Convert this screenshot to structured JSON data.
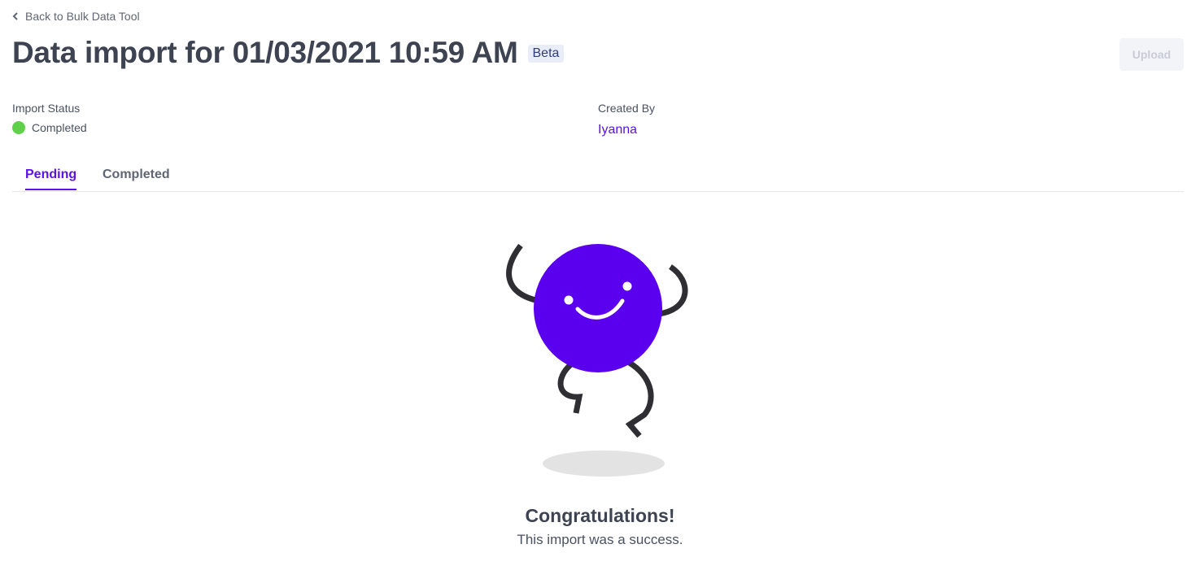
{
  "nav": {
    "back_label": "Back to Bulk Data Tool"
  },
  "header": {
    "title": "Data import for 01/03/2021 10:59 AM",
    "badge": "Beta",
    "upload_label": "Upload"
  },
  "meta": {
    "status_label": "Import Status",
    "status_value": "Completed",
    "status_color": "#5fd04a",
    "created_by_label": "Created By",
    "created_by_value": "Iyanna"
  },
  "tabs": [
    {
      "label": "Pending",
      "active": true
    },
    {
      "label": "Completed",
      "active": false
    }
  ],
  "empty_state": {
    "illustration": "happy-jumping-blob",
    "title": "Congratulations!",
    "message": "This import was a success."
  },
  "colors": {
    "accent": "#5a12e6",
    "text": "#3d4350"
  }
}
